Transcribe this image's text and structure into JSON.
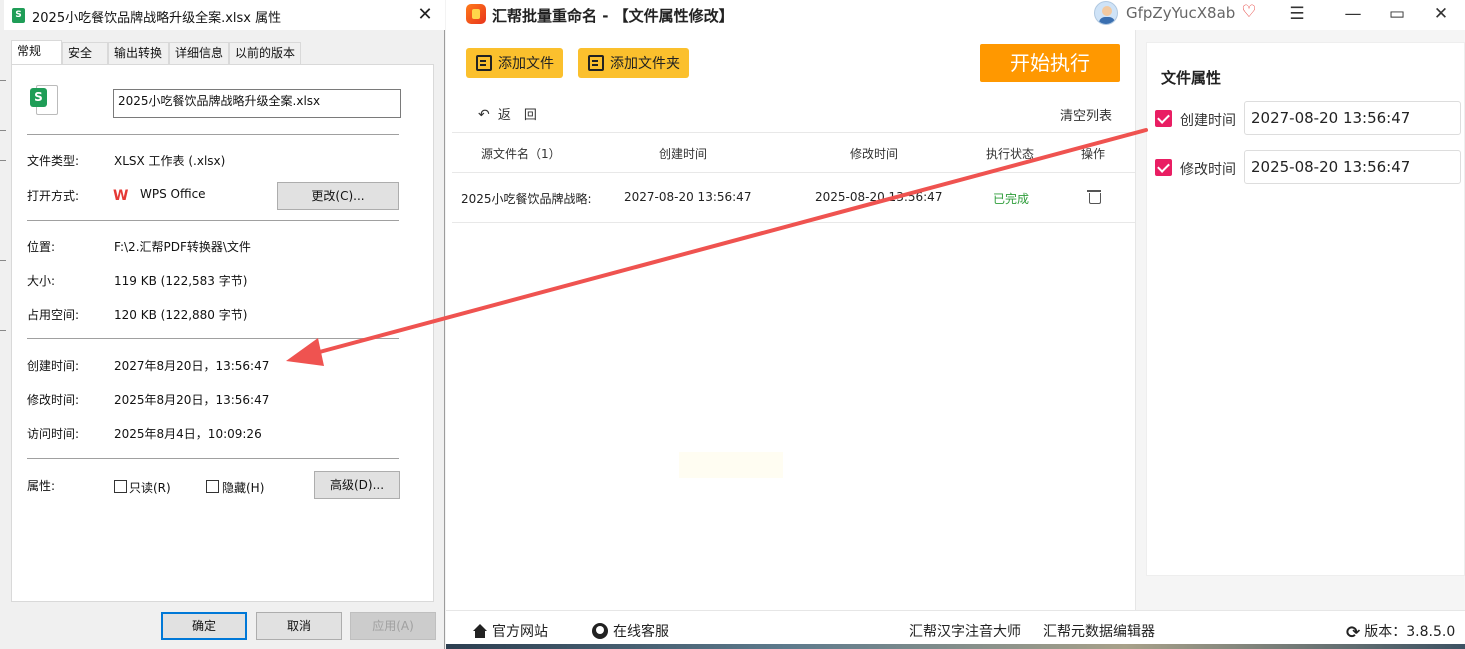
{
  "app": {
    "title": "汇帮批量重命名 - 【文件属性修改】",
    "username": "GfpZyYucX8ab",
    "add_file": "添加文件",
    "add_folder": "添加文件夹",
    "start": "开始执行",
    "back": "返　回",
    "clear": "清空列表",
    "columns": [
      "源文件名（1）",
      "创建时间",
      "修改时间",
      "执行状态",
      "操作"
    ],
    "rows": [
      {
        "name": "2025小吃餐饮品牌战略:",
        "created": "2027-08-20 13:56:47",
        "modified": "2025-08-20 13:56:47",
        "status": "已完成"
      }
    ],
    "panel": {
      "title": "文件属性",
      "created_label": "创建时间",
      "created_value": "2027-08-20 13:56:47",
      "modified_label": "修改时间",
      "modified_value": "2025-08-20 13:56:47"
    },
    "footer": {
      "site": "官方网站",
      "service": "在线客服",
      "tool1": "汇帮汉字注音大师",
      "tool2": "汇帮元数据编辑器",
      "version": "版本：3.8.5.0"
    },
    "colors": {
      "accent": "#ff9800",
      "button": "#fbc02d",
      "check": "#e91e63",
      "done": "#2e9d3a"
    }
  },
  "dialog": {
    "title": "2025小吃餐饮品牌战略升级全案.xlsx 属性",
    "tabs": [
      "常规",
      "安全",
      "输出转换",
      "详细信息",
      "以前的版本"
    ],
    "filename": "2025小吃餐饮品牌战略升级全案.xlsx",
    "type_label": "文件类型:",
    "type_value": "XLSX 工作表 (.xlsx)",
    "open_label": "打开方式:",
    "open_value": "WPS Office",
    "change_btn": "更改(C)...",
    "location_label": "位置:",
    "location_value": "F:\\2.汇帮PDF转换器\\文件",
    "size_label": "大小:",
    "size_value": "119 KB (122,583 字节)",
    "disk_label": "占用空间:",
    "disk_value": "120 KB (122,880 字节)",
    "created_label": "创建时间:",
    "created_value": "2027年8月20日，13:56:47",
    "modified_label": "修改时间:",
    "modified_value": "2025年8月20日，13:56:47",
    "accessed_label": "访问时间:",
    "accessed_value": "2025年8月4日，10:09:26",
    "attr_label": "属性:",
    "readonly": "只读(R)",
    "hidden": "隐藏(H)",
    "advanced": "高级(D)...",
    "ok": "确定",
    "cancel": "取消",
    "apply": "应用(A)"
  }
}
